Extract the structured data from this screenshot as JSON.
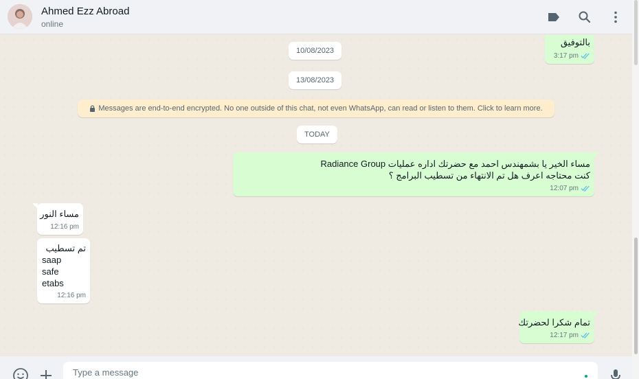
{
  "header": {
    "contact_name": "Ahmed Ezz Abroad",
    "status": "online",
    "icons": [
      "label-icon",
      "search-icon",
      "menu-icon"
    ]
  },
  "chat": {
    "dates": [
      "10/08/2023",
      "13/08/2023",
      "TODAY"
    ],
    "encryption_notice": "Messages are end-to-end encrypted. No one outside of this chat, not even WhatsApp, can read or listen to them. Click to learn more.",
    "messages": [
      {
        "direction": "out",
        "lines": [
          "بالتوفيق"
        ],
        "time": "3:17 pm",
        "status": "read"
      },
      {
        "direction": "out",
        "lines": [
          "مساء الخير يا بشمهندس احمد مع حضرتك اداره عمليات Radiance Group",
          "كنت محتاجه اعرف هل تم الانتهاء من تسطيب البرامج ؟"
        ],
        "time": "12:07 pm",
        "status": "read"
      },
      {
        "direction": "in",
        "lines": [
          "مساء النور"
        ],
        "time": "12:16 pm"
      },
      {
        "direction": "in",
        "lines": [
          "تم تسطيب",
          "saap",
          "safe",
          "etabs"
        ],
        "time": "12:16 pm"
      },
      {
        "direction": "out",
        "lines": [
          "تمام شكرا لحضرتك"
        ],
        "time": "12:17 pm",
        "status": "read"
      }
    ]
  },
  "composer": {
    "placeholder": "Type a message",
    "icons": [
      "emoji-icon",
      "attach-icon",
      "microphone-icon"
    ]
  },
  "colors": {
    "outgoing_bubble": "#d9fdd3",
    "incoming_bubble": "#ffffff",
    "read_tick": "#53bdeb",
    "chat_background": "#efeae2",
    "notice_background": "#ffeecd"
  }
}
